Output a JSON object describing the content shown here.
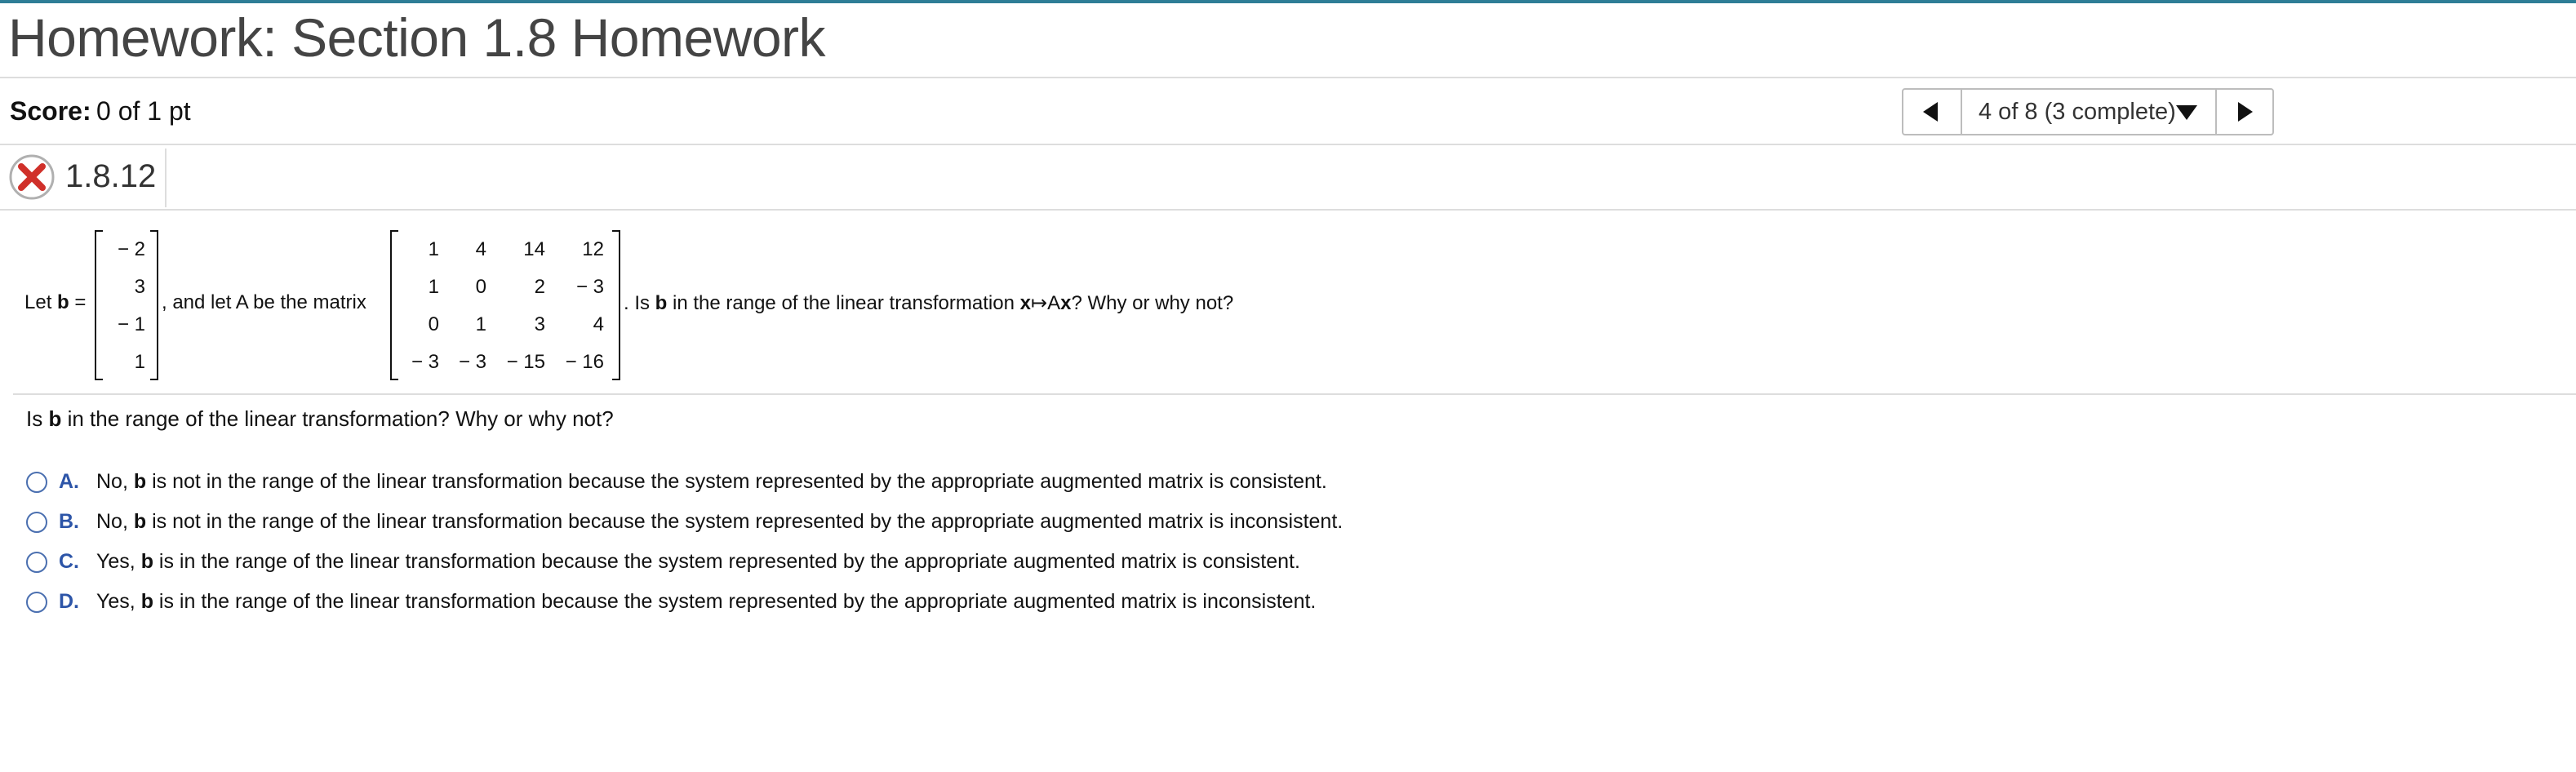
{
  "header": {
    "title": "Homework: Section 1.8 Homework",
    "score_label": "Score:",
    "score_value": "0 of 1 pt"
  },
  "nav": {
    "position_text": "4 of 8 (3 complete)"
  },
  "question": {
    "number": "1.8.12",
    "status": "incorrect",
    "prompt": {
      "let": "Let ",
      "b": "b",
      "eq": " =",
      "mid": ", and let A be the matrix",
      "end_pre": ". Is ",
      "end_b": "b",
      "end_post": " in the range of the linear transformation ",
      "map_x": "x",
      "map_arrow": "↦",
      "map_Ax_A": "A",
      "map_Ax_x": "x",
      "end_tail": "? Why or why not?"
    },
    "vector_b": [
      "− 2",
      "3",
      "− 1",
      "1"
    ],
    "matrix_A": [
      [
        "1",
        "4",
        "14",
        "12"
      ],
      [
        "1",
        "0",
        "2",
        "− 3"
      ],
      [
        "0",
        "1",
        "3",
        "4"
      ],
      [
        "− 3",
        "− 3",
        "− 15",
        "− 16"
      ]
    ],
    "sub": {
      "pre": "Is ",
      "b": "b",
      "post": " in the range of the linear transformation? Why or why not?"
    },
    "options": [
      {
        "letter": "A.",
        "pre": "No, ",
        "b": "b",
        "post": " is not in the range of the linear transformation because the system represented by the appropriate augmented matrix is consistent."
      },
      {
        "letter": "B.",
        "pre": "No, ",
        "b": "b",
        "post": " is not in the range of the linear transformation because the system represented by the appropriate augmented matrix is inconsistent."
      },
      {
        "letter": "C.",
        "pre": "Yes, ",
        "b": "b",
        "post": " is in the range of the linear transformation because the system represented by the appropriate augmented matrix is consistent."
      },
      {
        "letter": "D.",
        "pre": "Yes, ",
        "b": "b",
        "post": " is in the range of the linear transformation because the system represented by the appropriate augmented matrix is inconsistent."
      }
    ]
  },
  "colors": {
    "accent_line": "#2e7d96",
    "option_letter": "#2d55a8",
    "error_red": "#d0302a"
  }
}
